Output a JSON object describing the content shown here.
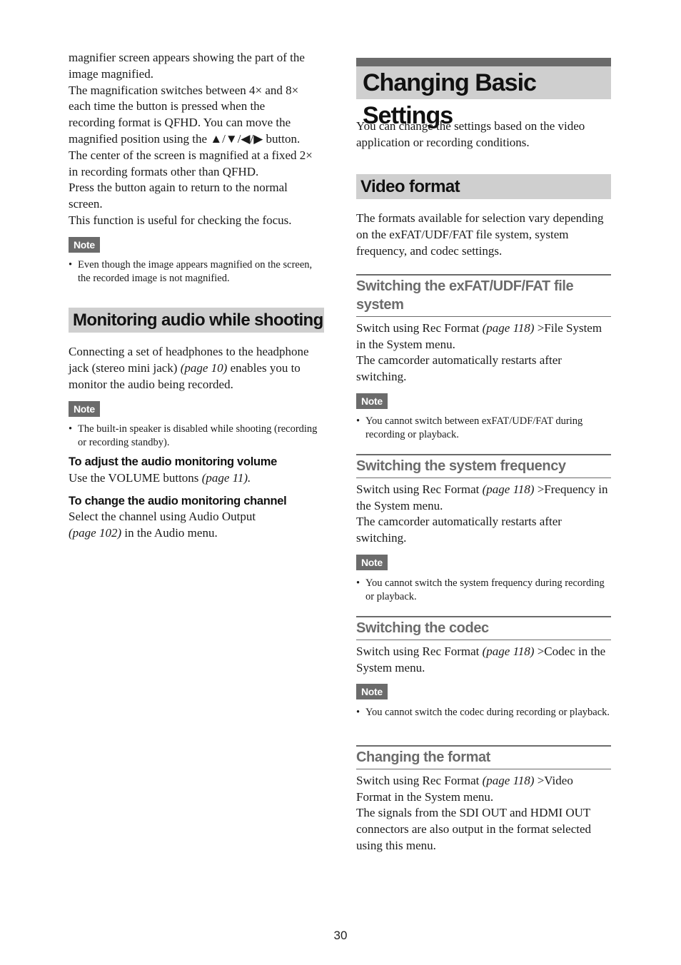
{
  "left_column": {
    "intro_lines": [
      "magnifier screen appears showing the part of the",
      "image magnified.",
      "The magnification switches between 4× and 8×",
      "each time the button is pressed when the",
      "recording format is QFHD. You can move the",
      "magnified position using the ▲/▼/◀/▶ button.",
      "The center of the screen is magnified at a fixed 2×",
      "in recording formats other than QFHD.",
      "Press the button again to return to the normal",
      "screen.",
      "This function is useful for checking the focus."
    ],
    "note1": {
      "label": "Note",
      "bullet": "Even though the image appears magnified on the screen, the recorded image is not magnified."
    },
    "section_monitoring": {
      "title": "Monitoring audio while shooting",
      "body_pre": "Connecting a set of headphones to the headphone jack (stereo mini jack) ",
      "body_ref": "(page 10)",
      "body_post": " enables you to monitor the audio being recorded.",
      "note": {
        "label": "Note",
        "bullet": "The built-in speaker is disabled while shooting (recording or recording standby)."
      },
      "volume": {
        "heading": "To adjust the audio monitoring volume",
        "body_pre": "Use the VOLUME buttons ",
        "body_ref": "(page 11)."
      },
      "channel": {
        "heading": "To change the audio monitoring channel",
        "body_pre": "Select the channel using Audio Output ",
        "body_ref": "(page 102)",
        "body_post": " in the Audio menu."
      }
    }
  },
  "right_column": {
    "main_title": "Changing Basic Settings",
    "intro": "You can change the settings based on the video application or recording conditions.",
    "video_format": {
      "title": "Video format",
      "intro": "The formats available for selection vary depending on the exFAT/UDF/FAT file system, system frequency, and codec settings."
    },
    "subsections": [
      {
        "title": "Switching the exFAT/UDF/FAT file system",
        "body_pre": "Switch using Rec Format ",
        "body_ref": "(page 118)",
        "body_post": " >File System in the System menu.",
        "body2": "The camcorder automatically restarts after switching.",
        "note_label": "Note",
        "note_bullet": "You cannot switch between exFAT/UDF/FAT during recording or playback."
      },
      {
        "title": "Switching the system frequency",
        "body_pre": "Switch using Rec Format ",
        "body_ref": "(page 118)",
        "body_post": " >Frequency in the System menu.",
        "body2": "The camcorder automatically restarts after switching.",
        "note_label": "Note",
        "note_bullet": "You cannot switch the system frequency during recording or playback."
      },
      {
        "title": "Switching the codec",
        "body_pre": "Switch using Rec Format ",
        "body_ref": "(page 118)",
        "body_post": " >Codec in the System menu.",
        "note_label": "Note",
        "note_bullet": "You cannot switch the codec during recording or playback."
      },
      {
        "title": "Changing the format",
        "body_pre": "Switch using Rec Format ",
        "body_ref": "(page 118)",
        "body_post": " >Video Format in the System menu.",
        "body2": "The signals from the SDI OUT and HDMI OUT connectors are also output in the format selected using this menu."
      }
    ]
  },
  "footer": {
    "page_number": "30"
  }
}
